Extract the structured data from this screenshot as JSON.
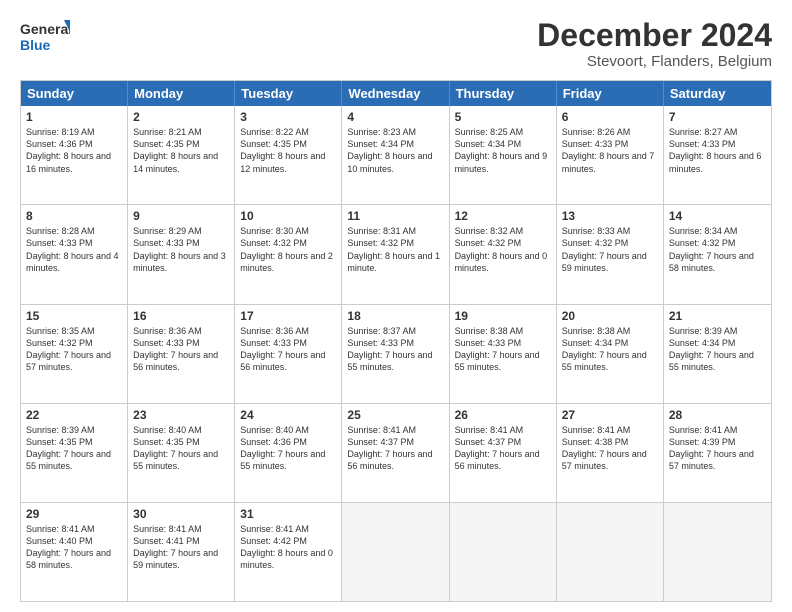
{
  "header": {
    "logo_line1": "General",
    "logo_line2": "Blue",
    "main_title": "December 2024",
    "sub_title": "Stevoort, Flanders, Belgium"
  },
  "days_of_week": [
    "Sunday",
    "Monday",
    "Tuesday",
    "Wednesday",
    "Thursday",
    "Friday",
    "Saturday"
  ],
  "weeks": [
    [
      {
        "day": "1",
        "text": "Sunrise: 8:19 AM\nSunset: 4:36 PM\nDaylight: 8 hours and 16 minutes."
      },
      {
        "day": "2",
        "text": "Sunrise: 8:21 AM\nSunset: 4:35 PM\nDaylight: 8 hours and 14 minutes."
      },
      {
        "day": "3",
        "text": "Sunrise: 8:22 AM\nSunset: 4:35 PM\nDaylight: 8 hours and 12 minutes."
      },
      {
        "day": "4",
        "text": "Sunrise: 8:23 AM\nSunset: 4:34 PM\nDaylight: 8 hours and 10 minutes."
      },
      {
        "day": "5",
        "text": "Sunrise: 8:25 AM\nSunset: 4:34 PM\nDaylight: 8 hours and 9 minutes."
      },
      {
        "day": "6",
        "text": "Sunrise: 8:26 AM\nSunset: 4:33 PM\nDaylight: 8 hours and 7 minutes."
      },
      {
        "day": "7",
        "text": "Sunrise: 8:27 AM\nSunset: 4:33 PM\nDaylight: 8 hours and 6 minutes."
      }
    ],
    [
      {
        "day": "8",
        "text": "Sunrise: 8:28 AM\nSunset: 4:33 PM\nDaylight: 8 hours and 4 minutes."
      },
      {
        "day": "9",
        "text": "Sunrise: 8:29 AM\nSunset: 4:33 PM\nDaylight: 8 hours and 3 minutes."
      },
      {
        "day": "10",
        "text": "Sunrise: 8:30 AM\nSunset: 4:32 PM\nDaylight: 8 hours and 2 minutes."
      },
      {
        "day": "11",
        "text": "Sunrise: 8:31 AM\nSunset: 4:32 PM\nDaylight: 8 hours and 1 minute."
      },
      {
        "day": "12",
        "text": "Sunrise: 8:32 AM\nSunset: 4:32 PM\nDaylight: 8 hours and 0 minutes."
      },
      {
        "day": "13",
        "text": "Sunrise: 8:33 AM\nSunset: 4:32 PM\nDaylight: 7 hours and 59 minutes."
      },
      {
        "day": "14",
        "text": "Sunrise: 8:34 AM\nSunset: 4:32 PM\nDaylight: 7 hours and 58 minutes."
      }
    ],
    [
      {
        "day": "15",
        "text": "Sunrise: 8:35 AM\nSunset: 4:32 PM\nDaylight: 7 hours and 57 minutes."
      },
      {
        "day": "16",
        "text": "Sunrise: 8:36 AM\nSunset: 4:33 PM\nDaylight: 7 hours and 56 minutes."
      },
      {
        "day": "17",
        "text": "Sunrise: 8:36 AM\nSunset: 4:33 PM\nDaylight: 7 hours and 56 minutes."
      },
      {
        "day": "18",
        "text": "Sunrise: 8:37 AM\nSunset: 4:33 PM\nDaylight: 7 hours and 55 minutes."
      },
      {
        "day": "19",
        "text": "Sunrise: 8:38 AM\nSunset: 4:33 PM\nDaylight: 7 hours and 55 minutes."
      },
      {
        "day": "20",
        "text": "Sunrise: 8:38 AM\nSunset: 4:34 PM\nDaylight: 7 hours and 55 minutes."
      },
      {
        "day": "21",
        "text": "Sunrise: 8:39 AM\nSunset: 4:34 PM\nDaylight: 7 hours and 55 minutes."
      }
    ],
    [
      {
        "day": "22",
        "text": "Sunrise: 8:39 AM\nSunset: 4:35 PM\nDaylight: 7 hours and 55 minutes."
      },
      {
        "day": "23",
        "text": "Sunrise: 8:40 AM\nSunset: 4:35 PM\nDaylight: 7 hours and 55 minutes."
      },
      {
        "day": "24",
        "text": "Sunrise: 8:40 AM\nSunset: 4:36 PM\nDaylight: 7 hours and 55 minutes."
      },
      {
        "day": "25",
        "text": "Sunrise: 8:41 AM\nSunset: 4:37 PM\nDaylight: 7 hours and 56 minutes."
      },
      {
        "day": "26",
        "text": "Sunrise: 8:41 AM\nSunset: 4:37 PM\nDaylight: 7 hours and 56 minutes."
      },
      {
        "day": "27",
        "text": "Sunrise: 8:41 AM\nSunset: 4:38 PM\nDaylight: 7 hours and 57 minutes."
      },
      {
        "day": "28",
        "text": "Sunrise: 8:41 AM\nSunset: 4:39 PM\nDaylight: 7 hours and 57 minutes."
      }
    ],
    [
      {
        "day": "29",
        "text": "Sunrise: 8:41 AM\nSunset: 4:40 PM\nDaylight: 7 hours and 58 minutes."
      },
      {
        "day": "30",
        "text": "Sunrise: 8:41 AM\nSunset: 4:41 PM\nDaylight: 7 hours and 59 minutes."
      },
      {
        "day": "31",
        "text": "Sunrise: 8:41 AM\nSunset: 4:42 PM\nDaylight: 8 hours and 0 minutes."
      },
      {
        "day": "",
        "text": ""
      },
      {
        "day": "",
        "text": ""
      },
      {
        "day": "",
        "text": ""
      },
      {
        "day": "",
        "text": ""
      }
    ]
  ]
}
